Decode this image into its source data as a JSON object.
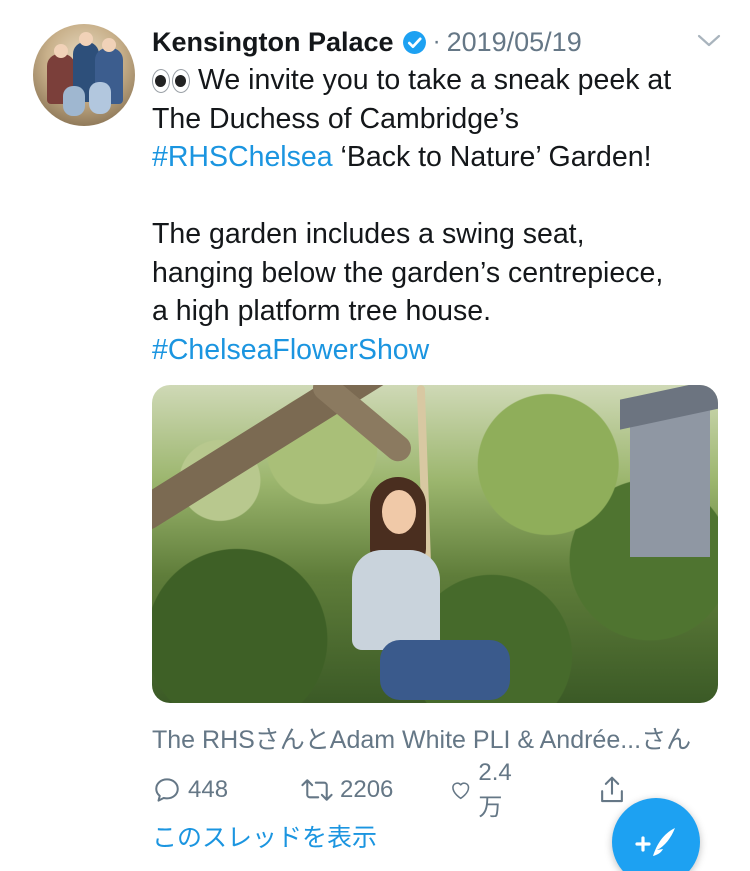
{
  "tweet": {
    "author_name": "Kensington Palace",
    "separator": "·",
    "date": "2019/05/19",
    "lines": [
      {
        "pre": "We invite you to take a sneak peek at"
      },
      {
        "pre": "The Duchess of Cambridge’s"
      },
      {
        "link": "#RHSChelsea",
        "post": " ‘Back to Nature’ Garden!"
      },
      {
        "pre": "The garden includes a swing seat,"
      },
      {
        "pre": "hanging below the garden’s centrepiece,"
      },
      {
        "pre": "a high platform tree house."
      },
      {
        "link": "#ChelseaFlowerShow"
      }
    ],
    "tagged_text": "The RHSさんとAdam White PLI & Andrée...さん",
    "actions": {
      "reply_count": "448",
      "retweet_count": "2206",
      "like_count": "2.4万"
    },
    "show_thread": "このスレッドを表示"
  },
  "icons": {
    "verified": "verified-badge-icon",
    "chevron": "chevron-down-icon",
    "reply": "reply-icon",
    "retweet": "retweet-icon",
    "like": "heart-icon",
    "share": "share-icon",
    "compose": "compose-tweet-icon",
    "eyes": "eyes-emoji-icon"
  },
  "colors": {
    "link": "#1b95e0",
    "muted": "#657786",
    "text": "#14171a",
    "accent": "#1da1f2"
  }
}
